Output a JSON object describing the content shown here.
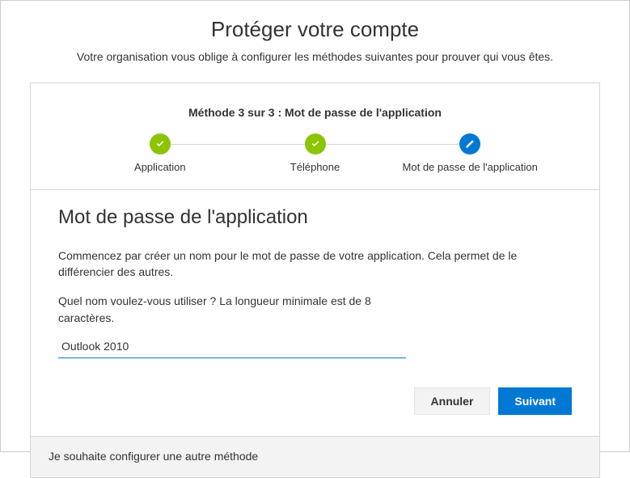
{
  "header": {
    "title": "Protéger votre compte",
    "subtitle": "Votre organisation vous oblige à configurer les méthodes suivantes pour prouver qui vous êtes."
  },
  "stepper": {
    "method_label": "Méthode 3 sur 3 : Mot de passe de l'application",
    "steps": [
      {
        "label": "Application",
        "state": "done"
      },
      {
        "label": "Téléphone",
        "state": "done"
      },
      {
        "label": "Mot de passe de l'application",
        "state": "active"
      }
    ]
  },
  "content": {
    "title": "Mot de passe de l'application",
    "description": "Commencez par créer un nom pour le mot de passe de votre application. Cela permet de le différencier des autres.",
    "input_label": "Quel nom voulez-vous utiliser ? La longueur minimale est de 8 caractères.",
    "input_value": "Outlook 2010"
  },
  "buttons": {
    "cancel": "Annuler",
    "next": "Suivant"
  },
  "footer": {
    "alternate_method": "Je souhaite configurer une autre méthode"
  }
}
